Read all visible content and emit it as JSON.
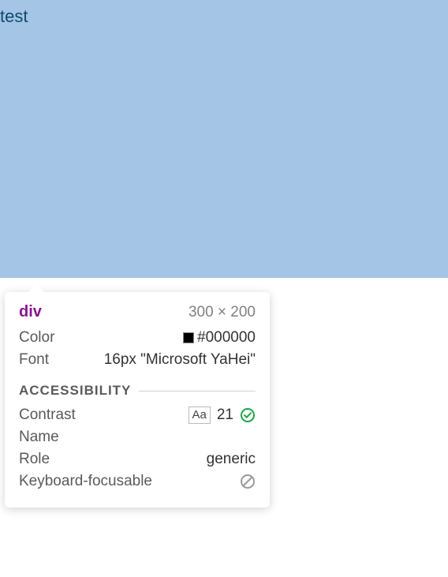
{
  "element": {
    "text": "test",
    "tag": "div",
    "dimensions": "300 × 200"
  },
  "properties": {
    "color_label": "Color",
    "color_value": "#000000",
    "font_label": "Font",
    "font_value": "16px \"Microsoft YaHei\""
  },
  "accessibility": {
    "section_title": "ACCESSIBILITY",
    "contrast_label": "Contrast",
    "contrast_aa": "Aa",
    "contrast_value": "21",
    "name_label": "Name",
    "name_value": "",
    "role_label": "Role",
    "role_value": "generic",
    "keyboard_label": "Keyboard-focusable"
  }
}
